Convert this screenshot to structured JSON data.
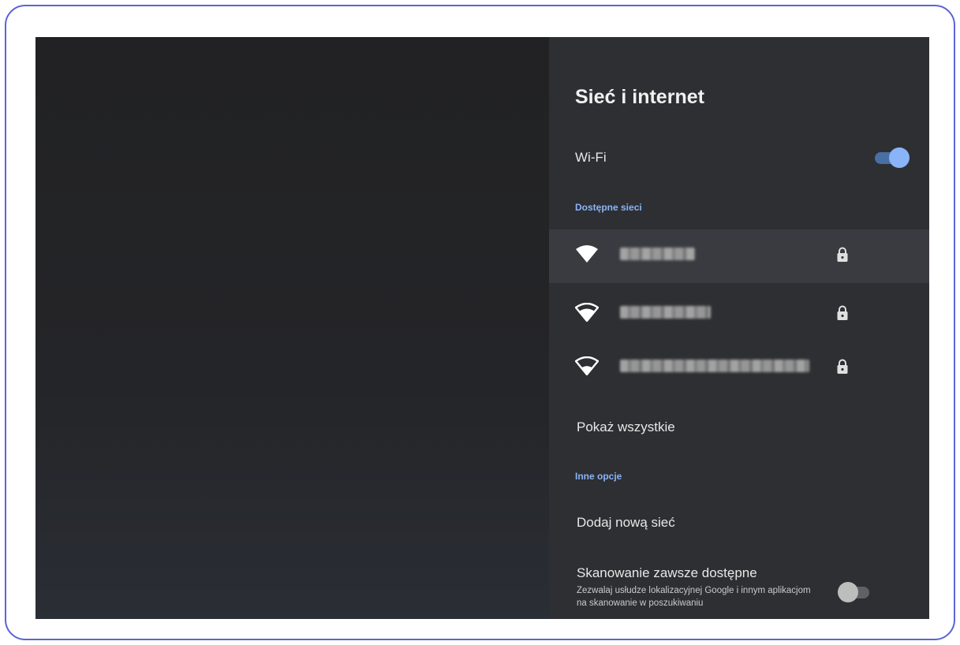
{
  "panel": {
    "title": "Sieć i internet",
    "wifi": {
      "label": "Wi-Fi",
      "enabled": true
    },
    "available_section": "Dostępne sieci",
    "networks": [
      {
        "name": "",
        "locked": true,
        "selected": true,
        "signal": "full"
      },
      {
        "name": "",
        "locked": true,
        "selected": false,
        "signal": "high"
      },
      {
        "name": "",
        "locked": true,
        "selected": false,
        "signal": "medium"
      }
    ],
    "show_all": "Pokaż wszystkie",
    "other_section": "Inne opcje",
    "add_network": "Dodaj nową sieć",
    "scan": {
      "title": "Skanowanie zawsze dostępne",
      "description": "Zezwalaj usłudze lokalizacyjnej Google i innym aplikacjom na skanowanie w poszukiwaniu",
      "enabled": false
    }
  },
  "colors": {
    "accent": "#8ab4f8",
    "frame": "#5b63d6",
    "panel_bg": "#2e2f33",
    "selected_bg": "#3a3b40"
  },
  "icons": {
    "wifi": "wifi-icon",
    "lock": "lock-icon"
  }
}
